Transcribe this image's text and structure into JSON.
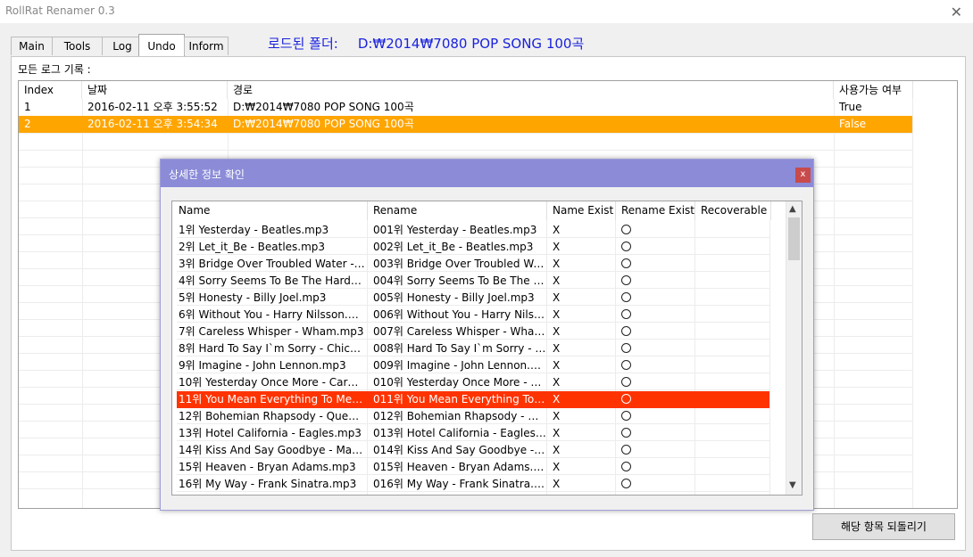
{
  "window": {
    "title": "RollRat Renamer 0.3"
  },
  "tabs": [
    {
      "label": "Main"
    },
    {
      "label": "Tools"
    },
    {
      "label": "Log"
    },
    {
      "label": "Undo"
    },
    {
      "label": "Inform"
    }
  ],
  "active_tab": "Undo",
  "loaded_folder": {
    "label": "로드된 폴더:",
    "path": "D:₩2014₩7080 POP SONG 100곡"
  },
  "log_panel": {
    "label": "모든 로그 기록 :",
    "columns": [
      "Index",
      "날짜",
      "경로",
      "사용가능 여부"
    ],
    "rows": [
      {
        "index": "1",
        "date": "2016-02-11 오후 3:55:52",
        "path": "D:₩2014₩7080 POP SONG 100곡",
        "available": "True"
      },
      {
        "index": "2",
        "date": "2016-02-11 오후 3:54:34",
        "path": "D:₩2014₩7080 POP SONG 100곡",
        "available": "False"
      }
    ],
    "selected_row": 2
  },
  "revert_button": "해당 항목 되돌리기",
  "dialog": {
    "title": "상세한 정보 확인",
    "close": "x",
    "columns": [
      "Name",
      "Rename",
      "Name Exist",
      "Rename Exist",
      "Recoverable"
    ],
    "rows": [
      {
        "name": "1위 Yesterday - Beatles.mp3",
        "rename": "001위 Yesterday - Beatles.mp3",
        "name_exist": "X"
      },
      {
        "name": "2위 Let_it_Be - Beatles.mp3",
        "rename": "002위 Let_it_Be - Beatles.mp3",
        "name_exist": "X"
      },
      {
        "name": "3위 Bridge Over Troubled Water - Si...",
        "rename": "003위 Bridge Over Troubled Wat...",
        "name_exist": "X"
      },
      {
        "name": "4위 Sorry Seems To Be The Hardest ...",
        "rename": "004위 Sorry Seems To Be The Ha...",
        "name_exist": "X"
      },
      {
        "name": "5위 Honesty - Billy Joel.mp3",
        "rename": "005위 Honesty - Billy Joel.mp3",
        "name_exist": "X"
      },
      {
        "name": "6위 Without You - Harry Nilsson.mp3",
        "rename": "006위 Without You - Harry Nilss...",
        "name_exist": "X"
      },
      {
        "name": "7위 Careless Whisper - Wham.mp3",
        "rename": "007위 Careless Whisper - Wham....",
        "name_exist": "X"
      },
      {
        "name": "8위 Hard To Say I`m Sorry - Chicago...",
        "rename": "008위 Hard To Say I`m Sorry - C...",
        "name_exist": "X"
      },
      {
        "name": "9위 Imagine - John Lennon.mp3",
        "rename": "009위 Imagine - John Lennon.m...",
        "name_exist": "X"
      },
      {
        "name": "10위 Yesterday Once More - Carpent...",
        "rename": "010위 Yesterday Once More - Ca...",
        "name_exist": "X"
      },
      {
        "name": "11위 You Mean Everything To Me - ...",
        "rename": "011위 You Mean Everything To ...",
        "name_exist": "X"
      },
      {
        "name": "12위 Bohemian Rhapsody - Queen....",
        "rename": "012위 Bohemian Rhapsody - Qu...",
        "name_exist": "X"
      },
      {
        "name": "13위 Hotel California - Eagles.mp3",
        "rename": "013위 Hotel California - Eagles....",
        "name_exist": "X"
      },
      {
        "name": "14위 Kiss And Say Goodbye - Manha...",
        "rename": "014위 Kiss And Say Goodbye - ...",
        "name_exist": "X"
      },
      {
        "name": "15위 Heaven - Bryan Adams.mp3",
        "rename": "015위 Heaven - Bryan Adams.mp3",
        "name_exist": "X"
      },
      {
        "name": "16위 My Way - Frank Sinatra.mp3",
        "rename": "016위 My Way - Frank Sinatra.m...",
        "name_exist": "X"
      }
    ],
    "highlighted_row": 11,
    "rename_exist_icon": "circle-icon"
  },
  "colors": {
    "selected_log_row": "#ffa500",
    "highlighted_grid_row": "#ff3300",
    "dialog_titlebar": "#8b8bd8",
    "dialog_close": "#c84a4a",
    "folder_text": "#1a22dd"
  }
}
